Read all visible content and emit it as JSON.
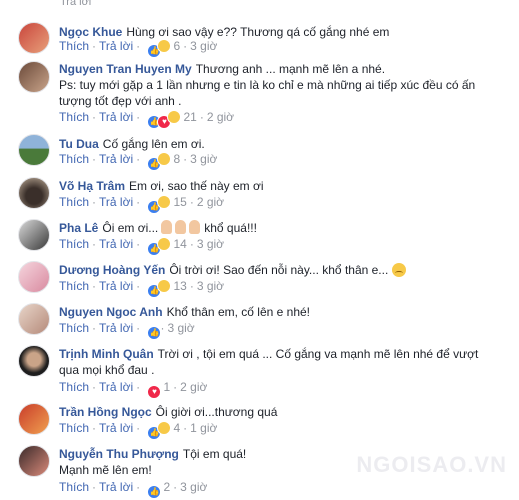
{
  "top_hint": "Trả lời",
  "actions": {
    "like": "Thích",
    "reply": "Trả lời"
  },
  "watermark": "NGOISAO.VN",
  "comments": [
    {
      "author": "Ngọc Khue",
      "text": "Hùng ơi sao vậy e?? Thương qá cố gắng nhé em",
      "reactions": [
        "like",
        "sad"
      ],
      "count": "6",
      "time": "3 giờ"
    },
    {
      "author": "Nguyen Tran Huyen My",
      "text": "Thương anh ... mạnh mẽ lên a nhé.",
      "text2": "Ps: tuy mới gặp a 1 lần nhưng e tin là ko chỉ e mà những ai tiếp xúc đều có ấn",
      "text3": "tượng tốt đẹp với anh .",
      "reactions": [
        "like",
        "love",
        "sad"
      ],
      "count": "21",
      "time": "2 giờ"
    },
    {
      "author": "Tu Dua",
      "text": "Cố gắng lên em ơi.",
      "reactions": [
        "like",
        "sad"
      ],
      "count": "8",
      "time": "3 giờ"
    },
    {
      "author": "Võ Hạ Trâm",
      "text": "Em ơi, sao thế này em ơi",
      "reactions": [
        "like",
        "sad"
      ],
      "count": "15",
      "time": "2 giờ"
    },
    {
      "author": "Pha Lê",
      "text": "Ôi em ơi...",
      "text_after": "khổ quá!!!",
      "reactions": [
        "like",
        "sad"
      ],
      "count": "14",
      "time": "3 giờ"
    },
    {
      "author": "Dương Hoàng Yến",
      "text": "Ôi trời ơi! Sao đến nỗi này... khổ thân e...",
      "reactions": [
        "like",
        "sad"
      ],
      "count": "13",
      "time": "3 giờ"
    },
    {
      "author": "Nguyen Ngoc Anh",
      "text": "Khổ thân em, cố lên e nhé!",
      "reactions": [
        "like"
      ],
      "count": "",
      "time": "3 giờ"
    },
    {
      "author": "Trịnh Minh Quân",
      "text": "Trời ơi , tội em quá ... Cố gắng va mạnh mẽ lên nhé để vượt",
      "text2": "qua mọi khổ đau .",
      "reactions": [
        "love"
      ],
      "count": "1",
      "time": "2 giờ"
    },
    {
      "author": "Trần Hồng Ngọc",
      "text": "Ôi giời ơi...thương quá",
      "reactions": [
        "like",
        "sad"
      ],
      "count": "4",
      "time": "1 giờ"
    },
    {
      "author": "Nguyễn Thu Phượng",
      "text": "Tội em quá!",
      "text2": "Mạnh mẽ lên em!",
      "reactions": [
        "like"
      ],
      "count": "2",
      "time": "3 giờ"
    }
  ]
}
